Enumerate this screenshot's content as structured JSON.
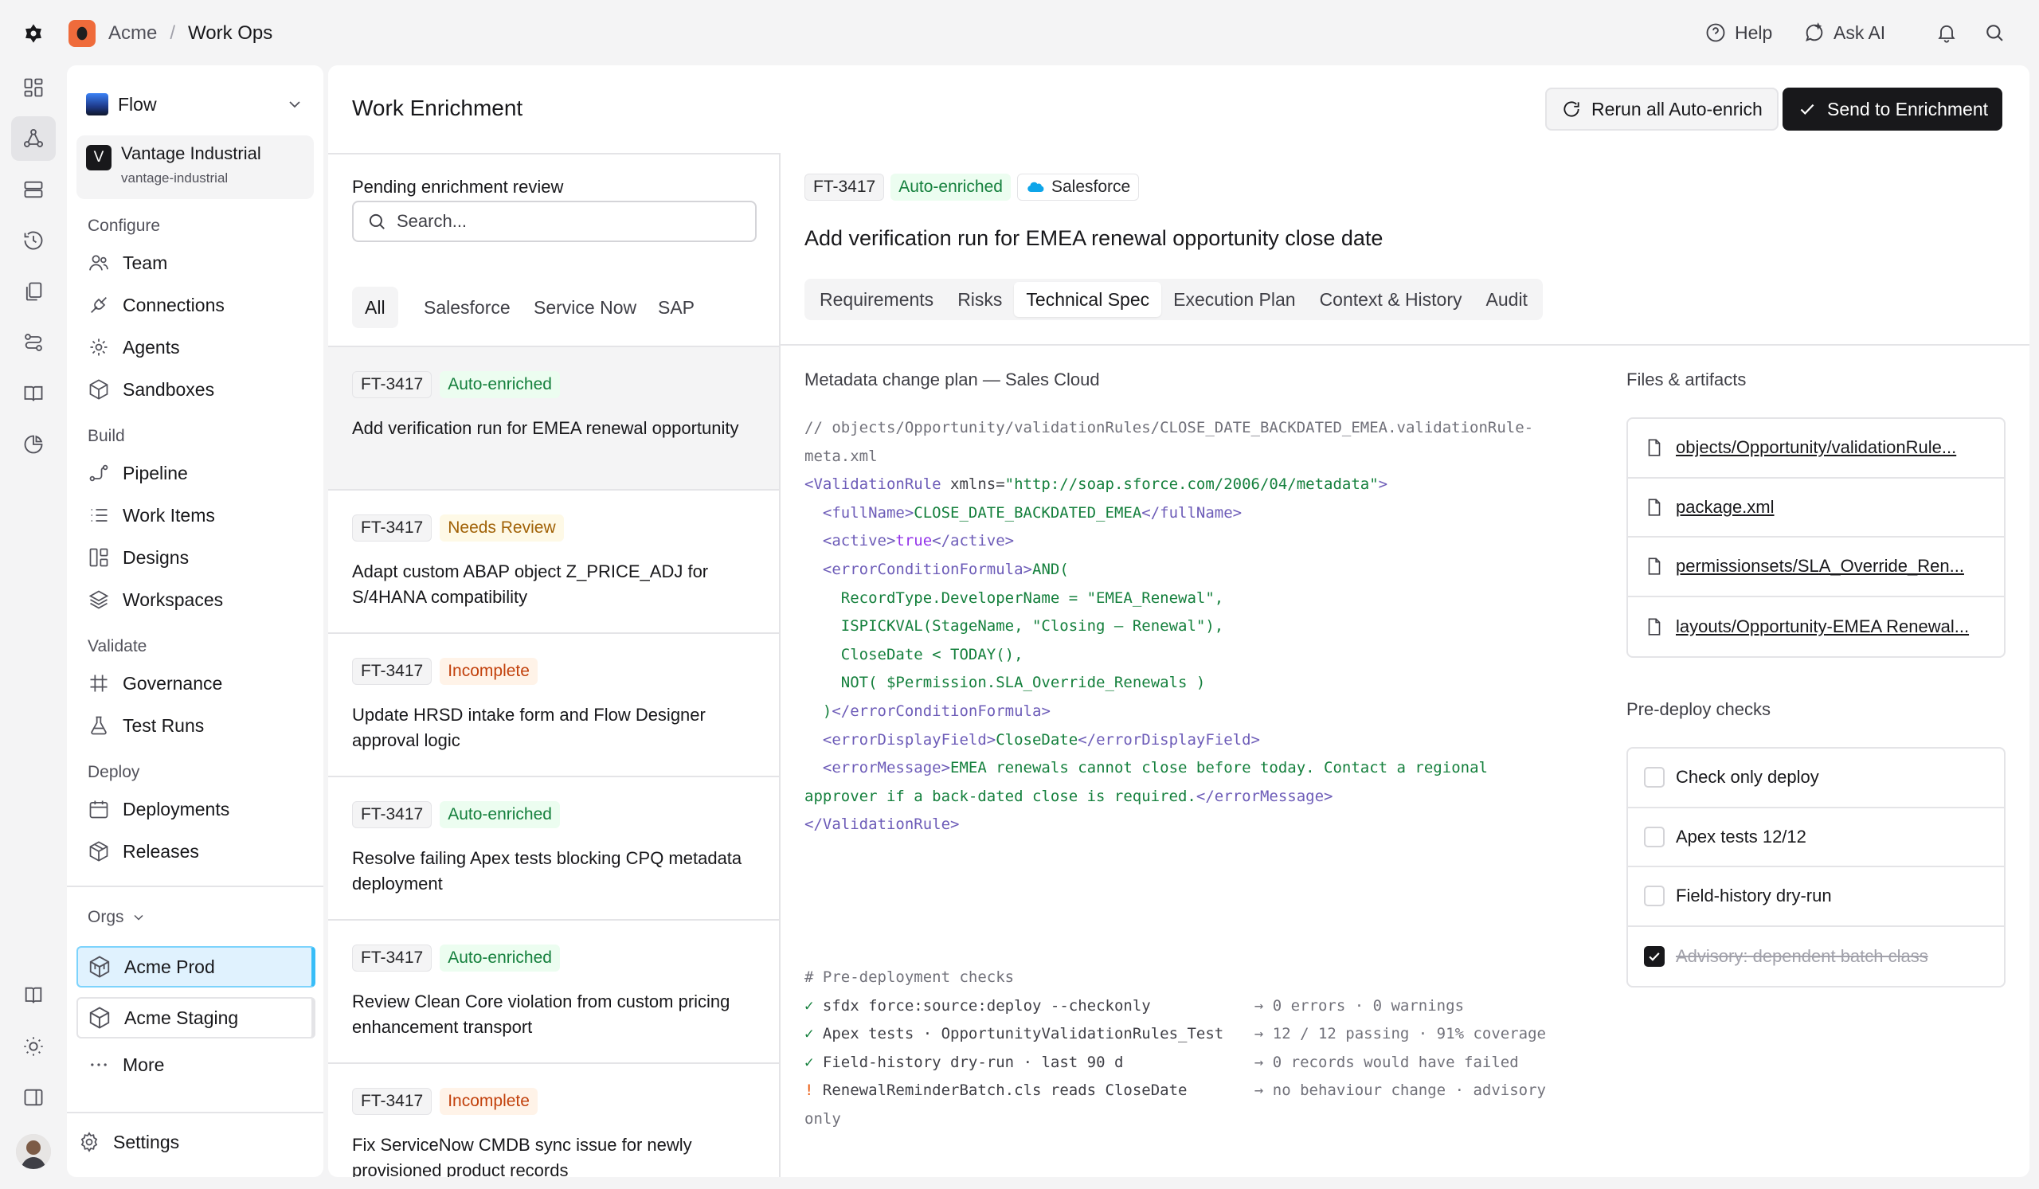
{
  "breadcrumb": {
    "org": "Acme",
    "separator": "/",
    "project": "Work Ops"
  },
  "topbar": {
    "help": "Help",
    "ask_ai": "Ask AI"
  },
  "nav": {
    "workspace": "Flow",
    "org_initial": "V",
    "org_name": "Vantage Industrial",
    "org_slug": "vantage-industrial",
    "sections": [
      {
        "label": "Configure",
        "items": [
          "Team",
          "Connections",
          "Agents",
          "Sandboxes"
        ]
      },
      {
        "label": "Build",
        "items": [
          "Pipeline",
          "Work Items",
          "Designs",
          "Workspaces"
        ]
      },
      {
        "label": "Validate",
        "items": [
          "Governance",
          "Test Runs"
        ]
      },
      {
        "label": "Deploy",
        "items": [
          "Deployments",
          "Releases"
        ]
      }
    ],
    "orgs_label": "Orgs",
    "envs": [
      "Acme Prod",
      "Acme Staging"
    ],
    "more": "More",
    "settings": "Settings"
  },
  "page": {
    "title": "Work Enrichment",
    "rerun_label": "Rerun all Auto-enrich",
    "send_label": "Send to Enrichment"
  },
  "list": {
    "heading": "Pending enrichment review",
    "search_placeholder": "Search...",
    "filters": [
      "All",
      "Salesforce",
      "Service Now",
      "SAP"
    ],
    "items": [
      {
        "id": "FT-3417",
        "status": "Auto-enriched",
        "kind": "auto",
        "title": "Add verification run for EMEA renewal opportunity"
      },
      {
        "id": "FT-3417",
        "status": "Needs Review",
        "kind": "review",
        "title": "Adapt custom ABAP object Z_PRICE_ADJ for S/4HANA compatibility"
      },
      {
        "id": "FT-3417",
        "status": "Incomplete",
        "kind": "incomplete",
        "title": "Update HRSD intake form and Flow Designer approval logic"
      },
      {
        "id": "FT-3417",
        "status": "Auto-enriched",
        "kind": "auto",
        "title": "Resolve failing Apex tests blocking CPQ metadata deployment"
      },
      {
        "id": "FT-3417",
        "status": "Auto-enriched",
        "kind": "auto",
        "title": "Review Clean Core violation from custom pricing enhancement transport"
      },
      {
        "id": "FT-3417",
        "status": "Incomplete",
        "kind": "incomplete",
        "title": "Fix ServiceNow CMDB sync issue for newly provisioned product records"
      }
    ]
  },
  "detail": {
    "id": "FT-3417",
    "status": "Auto-enriched",
    "source": "Salesforce",
    "title": "Add verification run for EMEA renewal opportunity close date",
    "tabs": [
      "Requirements",
      "Risks",
      "Technical Spec",
      "Execution Plan",
      "Context & History",
      "Audit"
    ],
    "plan_heading": "Metadata change plan — Sales Cloud",
    "code": {
      "comment1": "// objects/Opportunity/validationRules/CLOSE_DATE_BACKDATED_EMEA.validationRule-",
      "comment2": "meta.xml",
      "vr_open": "<ValidationRule",
      "attr_name": " xmlns=",
      "attr_val": "\"http://soap.sforce.com/2006/04/metadata\"",
      "gt": ">",
      "full_open": "<fullName>",
      "full_val": "CLOSE_DATE_BACKDATED_EMEA",
      "full_close": "</fullName>",
      "active_open": "<active>",
      "active_val": "true",
      "active_close": "</active>",
      "ecf_open": "<errorConditionFormula>",
      "ecf_l1": "AND(",
      "ecf_l2": "RecordType.DeveloperName = \"EMEA_Renewal\",",
      "ecf_l3": "ISPICKVAL(StageName, \"Closing – Renewal\"),",
      "ecf_l4": "CloseDate < TODAY(),",
      "ecf_l5": "NOT( $Permission.SLA_Override_Renewals )",
      "ecf_l6": ")",
      "ecf_close": "</errorConditionFormula>",
      "edf_open": "<errorDisplayField>",
      "edf_val": "CloseDate",
      "edf_close": "</errorDisplayField>",
      "em_open": "<errorMessage>",
      "em_val1": "EMEA renewals cannot close before today. Contact a regional",
      "em_val2": "approver if a back-dated close is required.",
      "em_close": "</errorMessage>",
      "vr_close": "</ValidationRule>"
    },
    "checks_comment": "# Pre-deployment checks",
    "check_lines": [
      {
        "mark": "✓",
        "cmd": "sfdx force:source:deploy --checkonly",
        "result": "→ 0 errors · 0 warnings",
        "kind": "ok"
      },
      {
        "mark": "✓",
        "cmd": "Apex tests · OpportunityValidationRules_Test",
        "result": "→ 12 / 12 passing · 91% coverage",
        "kind": "ok"
      },
      {
        "mark": "✓",
        "cmd": "Field-history dry-run · last 90 d",
        "result": "→ 0 records would have failed",
        "kind": "ok"
      },
      {
        "mark": "!",
        "cmd": "RenewalReminderBatch.cls reads CloseDate",
        "result": "→ no behaviour change · advisory",
        "kind": "warn"
      }
    ],
    "checks_wrap": "only",
    "files_heading": "Files & artifacts",
    "files": [
      "objects/Opportunity/validationRule...",
      "package.xml",
      "permissionsets/SLA_Override_Ren...",
      "layouts/Opportunity-EMEA Renewal..."
    ],
    "predeploy_heading": "Pre-deploy checks",
    "predeploy": [
      {
        "label": "Check only deploy",
        "checked": false
      },
      {
        "label": "Apex tests 12/12",
        "checked": false
      },
      {
        "label": "Field-history dry-run",
        "checked": false
      },
      {
        "label": "Advisory: dependent batch class",
        "checked": true
      }
    ]
  }
}
